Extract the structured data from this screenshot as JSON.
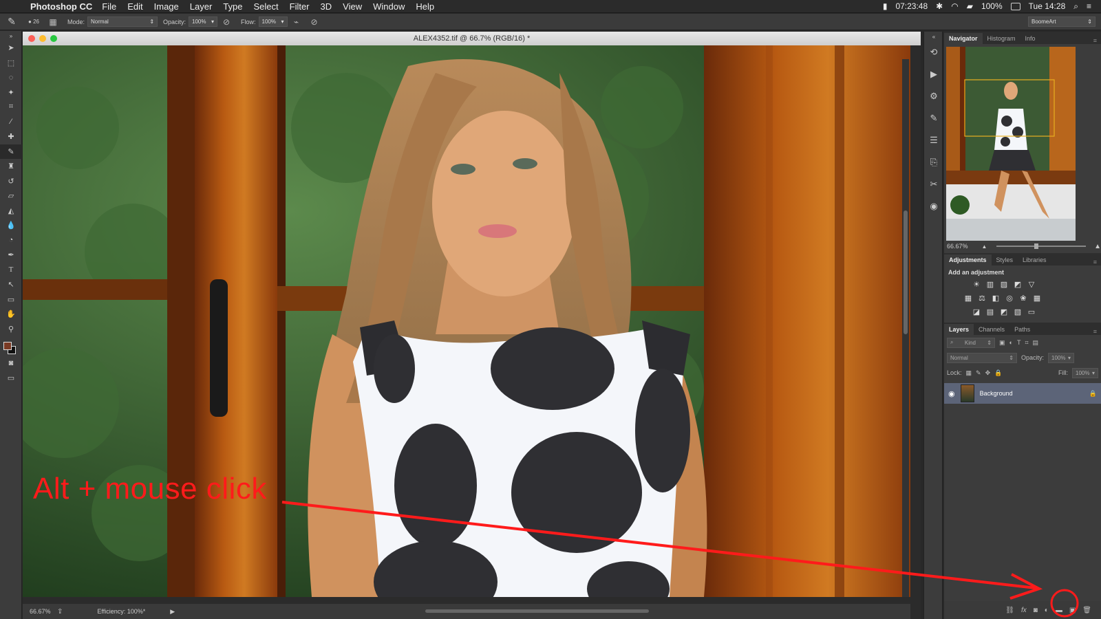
{
  "menubar": {
    "app_name": "Photoshop CC",
    "items": [
      "File",
      "Edit",
      "Image",
      "Layer",
      "Type",
      "Select",
      "Filter",
      "3D",
      "View",
      "Window",
      "Help"
    ],
    "status_time": "07:23:48",
    "battery": "100%",
    "clock": "Tue 14:28"
  },
  "options": {
    "brush_size": "26",
    "mode_label": "Mode:",
    "mode_value": "Normal",
    "opacity_label": "Opacity:",
    "opacity_value": "100%",
    "flow_label": "Flow:",
    "flow_value": "100%",
    "workspace": "BoomeArt"
  },
  "document": {
    "title": "ALEX4352.tif @ 66.7% (RGB/16) *",
    "zoom": "66.67%",
    "efficiency": "Efficiency: 100%*"
  },
  "navigator": {
    "tabs": [
      "Navigator",
      "Histogram",
      "Info"
    ],
    "zoom": "66.67%"
  },
  "adjustments": {
    "tabs": [
      "Adjustments",
      "Styles",
      "Libraries"
    ],
    "add_label": "Add an adjustment"
  },
  "layers": {
    "tabs": [
      "Layers",
      "Channels",
      "Paths"
    ],
    "kind_placeholder": "Kind",
    "blend_mode": "Normal",
    "opacity_label": "Opacity:",
    "opacity_value": "100%",
    "lock_label": "Lock:",
    "fill_label": "Fill:",
    "fill_value": "100%",
    "layer_name": "Background"
  },
  "annotation": {
    "text": "Alt + mouse click",
    "color": "#ff1b1b"
  },
  "colors": {
    "foreground": "#7a3a24",
    "background": "#111111",
    "selected_layer": "#5c6478"
  }
}
